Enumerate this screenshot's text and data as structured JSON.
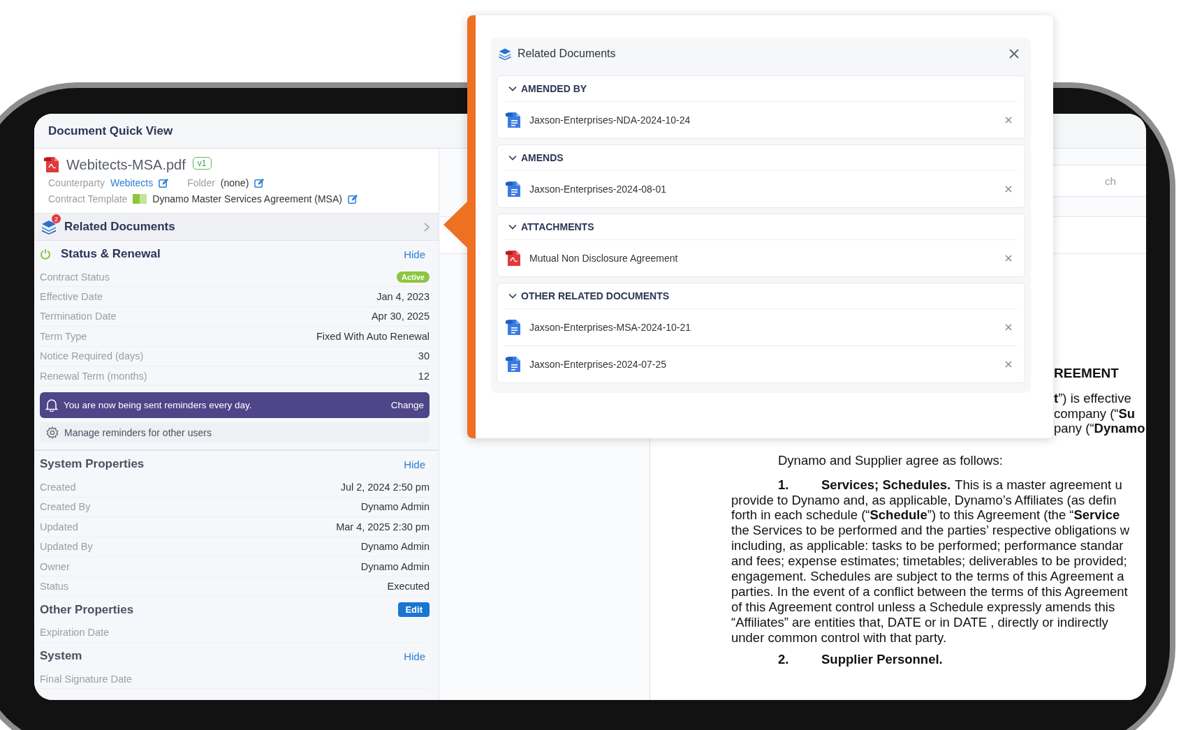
{
  "app_header": {
    "title": "Document Quick View"
  },
  "file": {
    "name": "Webitects-MSA.pdf",
    "version": "v1"
  },
  "meta": [
    {
      "label": "Counterparty",
      "value": "Webitects",
      "kind": "link"
    },
    {
      "label": "Folder",
      "value": "(none)",
      "kind": "text"
    }
  ],
  "template": {
    "label": "Contract Template",
    "value": "Dynamo Master Services Agreement (MSA)"
  },
  "related_documents": {
    "title": "Related Documents",
    "count": "2"
  },
  "sections": [
    {
      "title": "Status & Renewal",
      "kind": "with_icon",
      "action": {
        "label": "Hide",
        "kind": "link"
      },
      "rows": [
        {
          "label": "Contract Status",
          "value": "Active",
          "kind": "badge"
        },
        {
          "label": "Effective Date",
          "value": "Jan 4, 2023",
          "kind": "text"
        },
        {
          "label": "Termination Date",
          "value": "Apr 30, 2025",
          "kind": "text"
        },
        {
          "label": "Term Type",
          "value": "Fixed With Auto Renewal",
          "kind": "text"
        },
        {
          "label": "Notice Required (days)",
          "value": "30",
          "kind": "text"
        },
        {
          "label": "Renewal Term (months)",
          "value": "12",
          "kind": "text"
        }
      ],
      "reminder": {
        "text": "You are now being sent reminders every day.",
        "action": "Change"
      },
      "manage_link": "Manage reminders for other users"
    },
    {
      "title": "System Properties",
      "kind": "plain",
      "action": {
        "label": "Hide",
        "kind": "link"
      },
      "rows": [
        {
          "label": "Created",
          "value": "Jul 2, 2024 2:50 pm",
          "kind": "text"
        },
        {
          "label": "Created By",
          "value": "Dynamo Admin",
          "kind": "text"
        },
        {
          "label": "Updated",
          "value": "Mar 4, 2025 2:30 pm",
          "kind": "text"
        },
        {
          "label": "Updated By",
          "value": "Dynamo Admin",
          "kind": "text"
        },
        {
          "label": "Owner",
          "value": "Dynamo Admin",
          "kind": "text"
        },
        {
          "label": "Status",
          "value": "Executed",
          "kind": "text"
        }
      ]
    },
    {
      "title": "Other Properties",
      "kind": "plain",
      "action": {
        "label": "Edit",
        "kind": "button"
      },
      "rows": [
        {
          "label": "Expiration Date",
          "kind": "text"
        }
      ]
    },
    {
      "title": "System",
      "kind": "plain",
      "action": {
        "label": "Hide",
        "kind": "link"
      },
      "rows": [
        {
          "label": "Final Signature Date",
          "kind": "text"
        }
      ]
    }
  ],
  "viewer": {
    "search": {
      "placeholder": "ch"
    },
    "document": {
      "heading_fragment": "REEMENT",
      "cut_lines": [
        "**t**”) is effective",
        "company (“**Su**",
        "pany (“**Dynamo**"
      ],
      "intro": "Dynamo and Supplier agree as follows:",
      "clauses": [
        {
          "number": "1.",
          "title": "Services; Schedules.",
          "first_line": "This is a master agreement u",
          "lines": [
            "provide to Dynamo and, as applicable, Dynamo’s Affiliates (as defin",
            "forth in each schedule (“**Schedule**”) to this Agreement (the “**Service**",
            "the Services to be performed and the parties’ respective obligations w",
            "including, as applicable: tasks to be performed; performance standar",
            "and fees; expense estimates; timetables; deliverables to be provided;",
            "engagement. Schedules are subject to the terms of this Agreement a",
            "parties. In the event of a conflict between the terms of this Agreement",
            "of this Agreement control unless a Schedule expressly amends this",
            "“Affiliates” are entities that, DATE or in DATE , directly or indirectly",
            "under common control with that party."
          ]
        },
        {
          "number": "2.",
          "title": "Supplier Personnel."
        }
      ]
    }
  },
  "popup": {
    "title": "Related Documents",
    "groups": [
      {
        "title": "AMENDED BY",
        "expanded": true,
        "items": [
          {
            "name": "Jaxson-Enterprises-NDA-2024-10-24",
            "kind": "docx"
          }
        ]
      },
      {
        "title": "AMENDS",
        "expanded": true,
        "items": [
          {
            "name": "Jaxson-Enterprises-2024-08-01",
            "kind": "docx"
          }
        ]
      },
      {
        "title": "ATTACHMENTS",
        "expanded": true,
        "items": [
          {
            "name": "Mutual Non Disclosure Agreement",
            "kind": "pdf"
          }
        ]
      },
      {
        "title": "OTHER RELATED DOCUMENTS",
        "expanded": true,
        "items": [
          {
            "name": "Jaxson-Enterprises-MSA-2024-10-21",
            "kind": "docx"
          },
          {
            "name": "Jaxson-Enterprises-2024-07-25",
            "kind": "docx"
          }
        ]
      }
    ]
  }
}
